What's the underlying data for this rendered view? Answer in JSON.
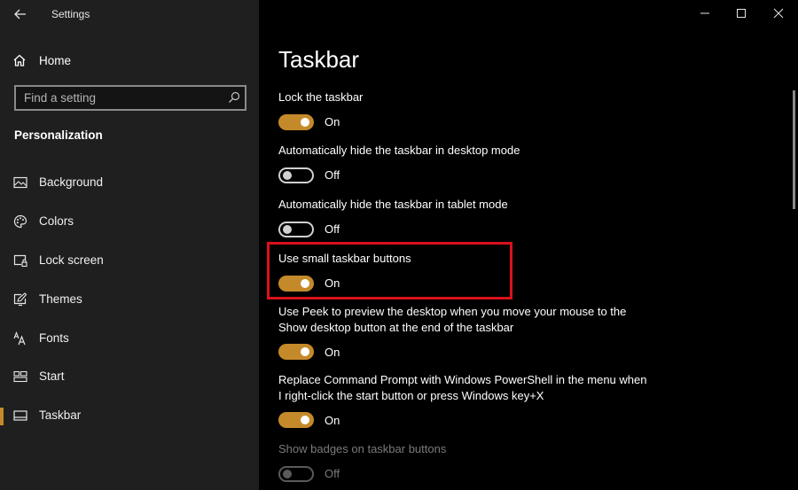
{
  "window": {
    "title": "Settings",
    "back_icon": "back-arrow-icon",
    "controls": [
      "minimize-icon",
      "maximize-icon",
      "close-icon"
    ]
  },
  "sidebar": {
    "home_label": "Home",
    "search_placeholder": "Find a setting",
    "section_header": "Personalization",
    "items": [
      {
        "label": "Background",
        "icon": "picture-icon",
        "selected": false
      },
      {
        "label": "Colors",
        "icon": "palette-icon",
        "selected": false
      },
      {
        "label": "Lock screen",
        "icon": "lock-screen-icon",
        "selected": false
      },
      {
        "label": "Themes",
        "icon": "themes-icon",
        "selected": false
      },
      {
        "label": "Fonts",
        "icon": "fonts-icon",
        "selected": false
      },
      {
        "label": "Start",
        "icon": "start-icon",
        "selected": false
      },
      {
        "label": "Taskbar",
        "icon": "taskbar-icon",
        "selected": true
      }
    ]
  },
  "main": {
    "title": "Taskbar",
    "settings": [
      {
        "label": "Lock the taskbar",
        "state": "On",
        "on": true,
        "disabled": false
      },
      {
        "label": "Automatically hide the taskbar in desktop mode",
        "state": "Off",
        "on": false,
        "disabled": false
      },
      {
        "label": "Automatically hide the taskbar in tablet mode",
        "state": "Off",
        "on": false,
        "disabled": false
      },
      {
        "label": "Use small taskbar buttons",
        "state": "On",
        "on": true,
        "disabled": false,
        "highlighted": true
      },
      {
        "label": "Use Peek to preview the desktop when you move your mouse to the Show desktop button at the end of the taskbar",
        "state": "On",
        "on": true,
        "disabled": false
      },
      {
        "label": "Replace Command Prompt with Windows PowerShell in the menu when I right-click the start button or press Windows key+X",
        "state": "On",
        "on": true,
        "disabled": false
      },
      {
        "label": "Show badges on taskbar buttons",
        "state": "Off",
        "on": false,
        "disabled": true
      }
    ]
  },
  "colors": {
    "accent": "#c48a2a",
    "highlight": "#d9111b",
    "sidebar_bg": "#1f1f1f",
    "main_bg": "#000000"
  }
}
